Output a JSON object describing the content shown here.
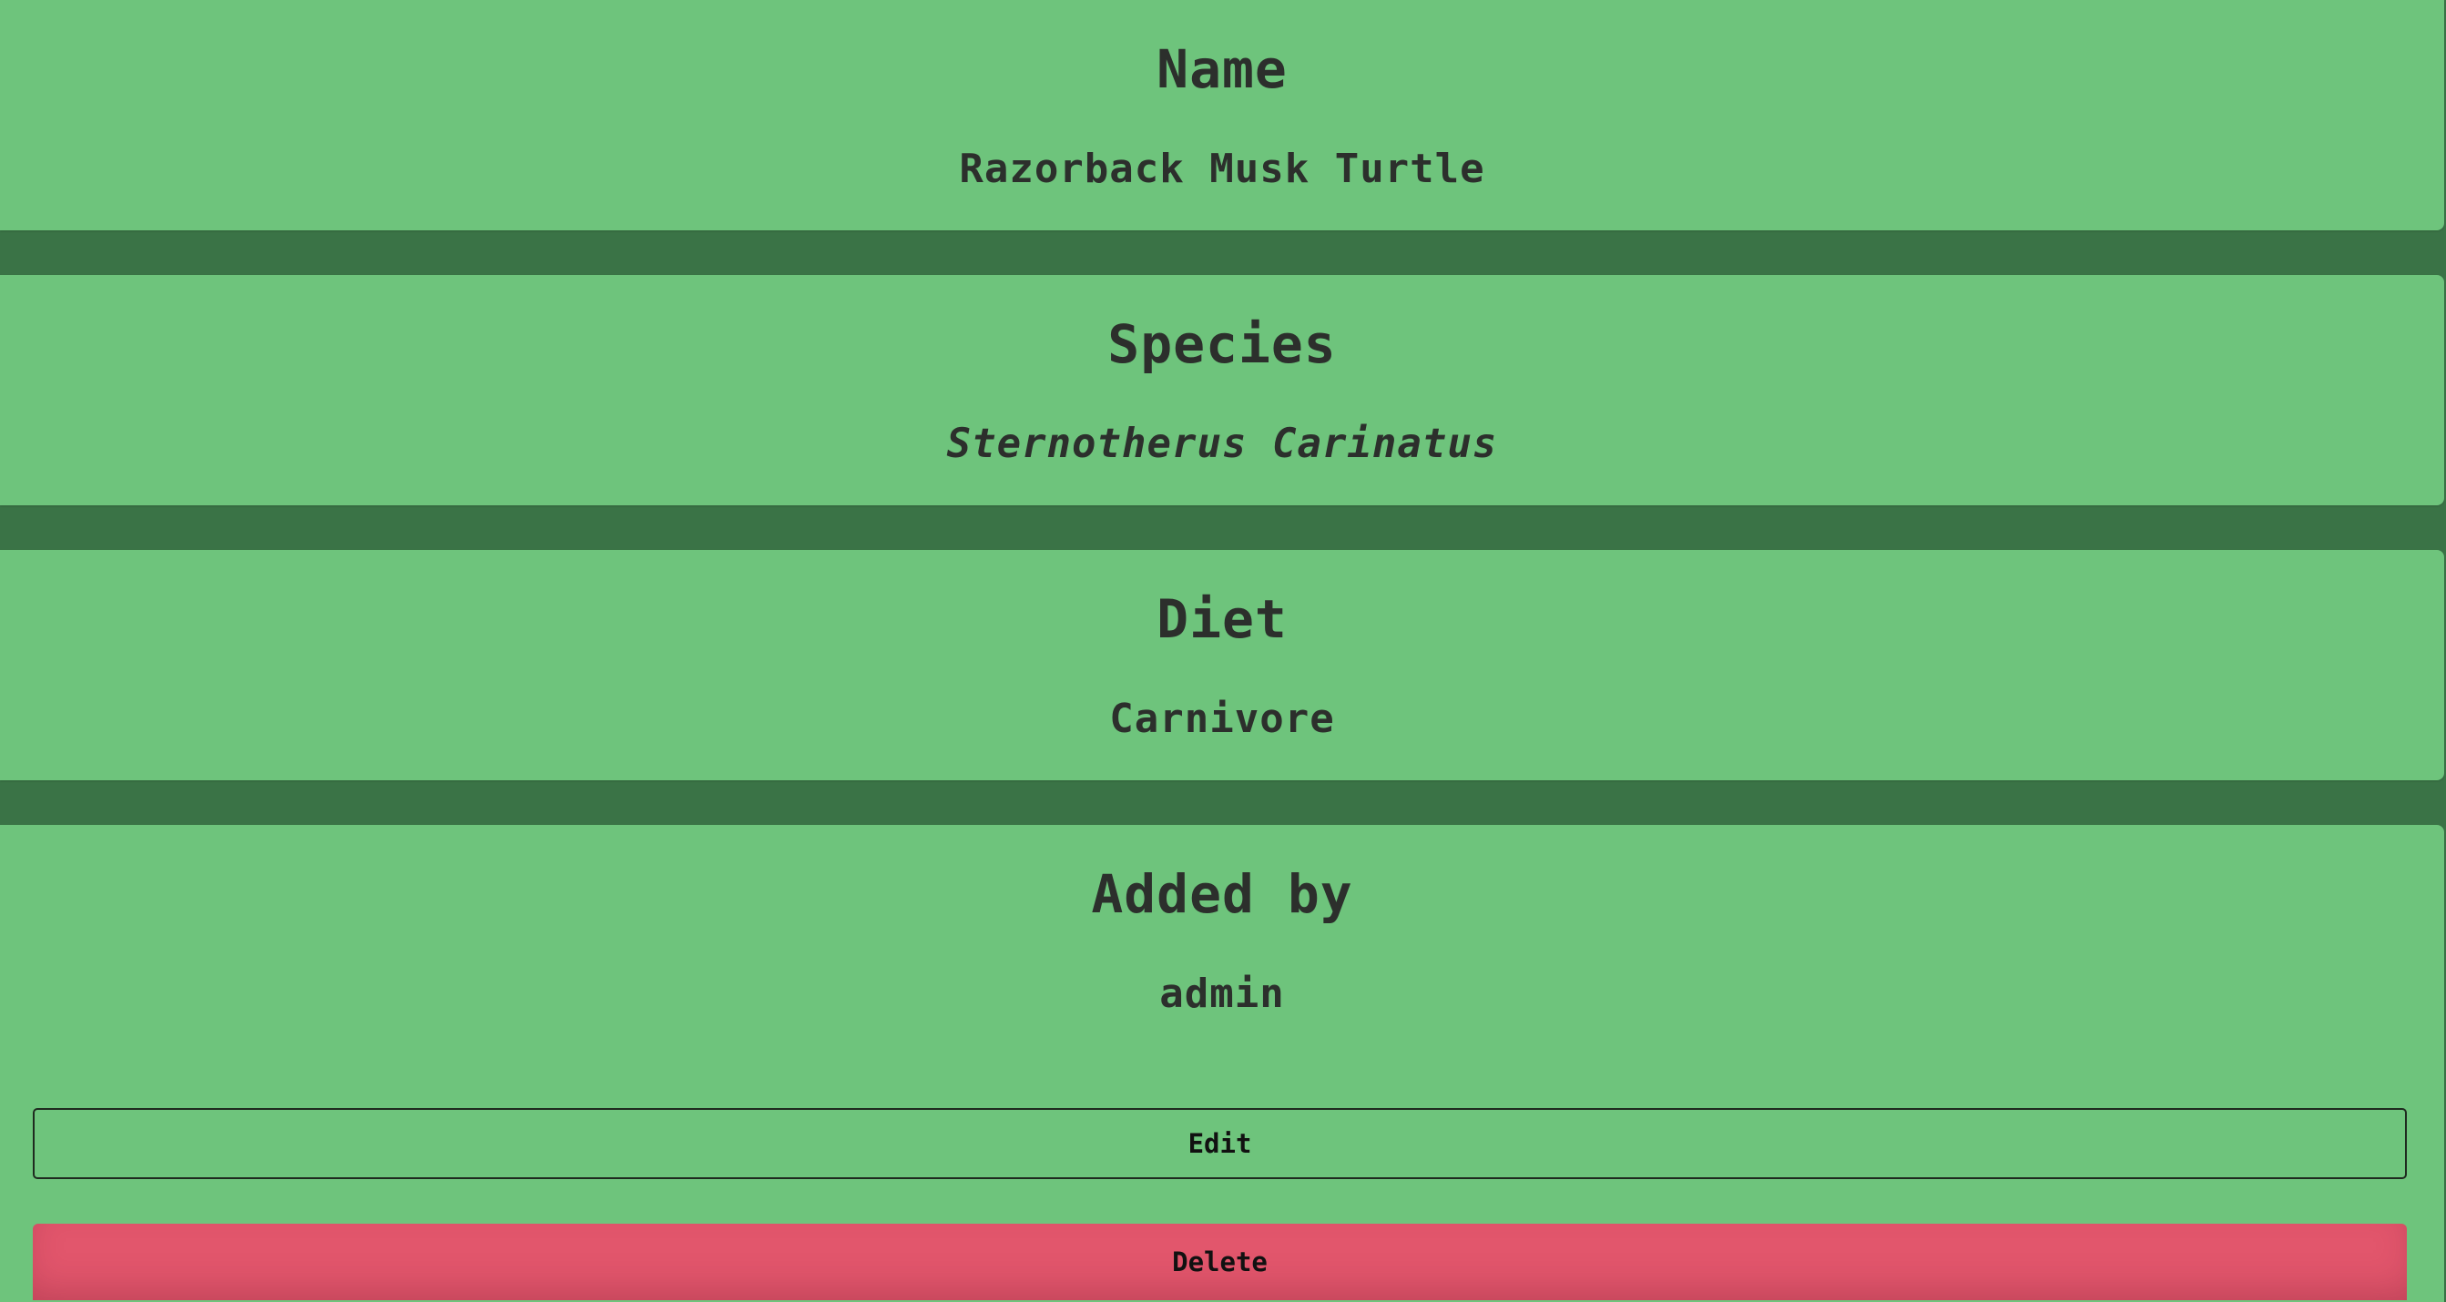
{
  "name_card": {
    "heading": "Name",
    "value": "Razorback Musk Turtle"
  },
  "species_card": {
    "heading": "Species",
    "value": "Sternotherus Carinatus"
  },
  "diet_card": {
    "heading": "Diet",
    "value": "Carnivore"
  },
  "added_card": {
    "heading": "Added by",
    "value": "admin"
  },
  "actions": {
    "edit_label": "Edit",
    "delete_label": "Delete"
  },
  "colors": {
    "background": "#3a7346",
    "card": "#6ec47c",
    "text": "#2c2f2c",
    "delete": "#e2566c"
  }
}
